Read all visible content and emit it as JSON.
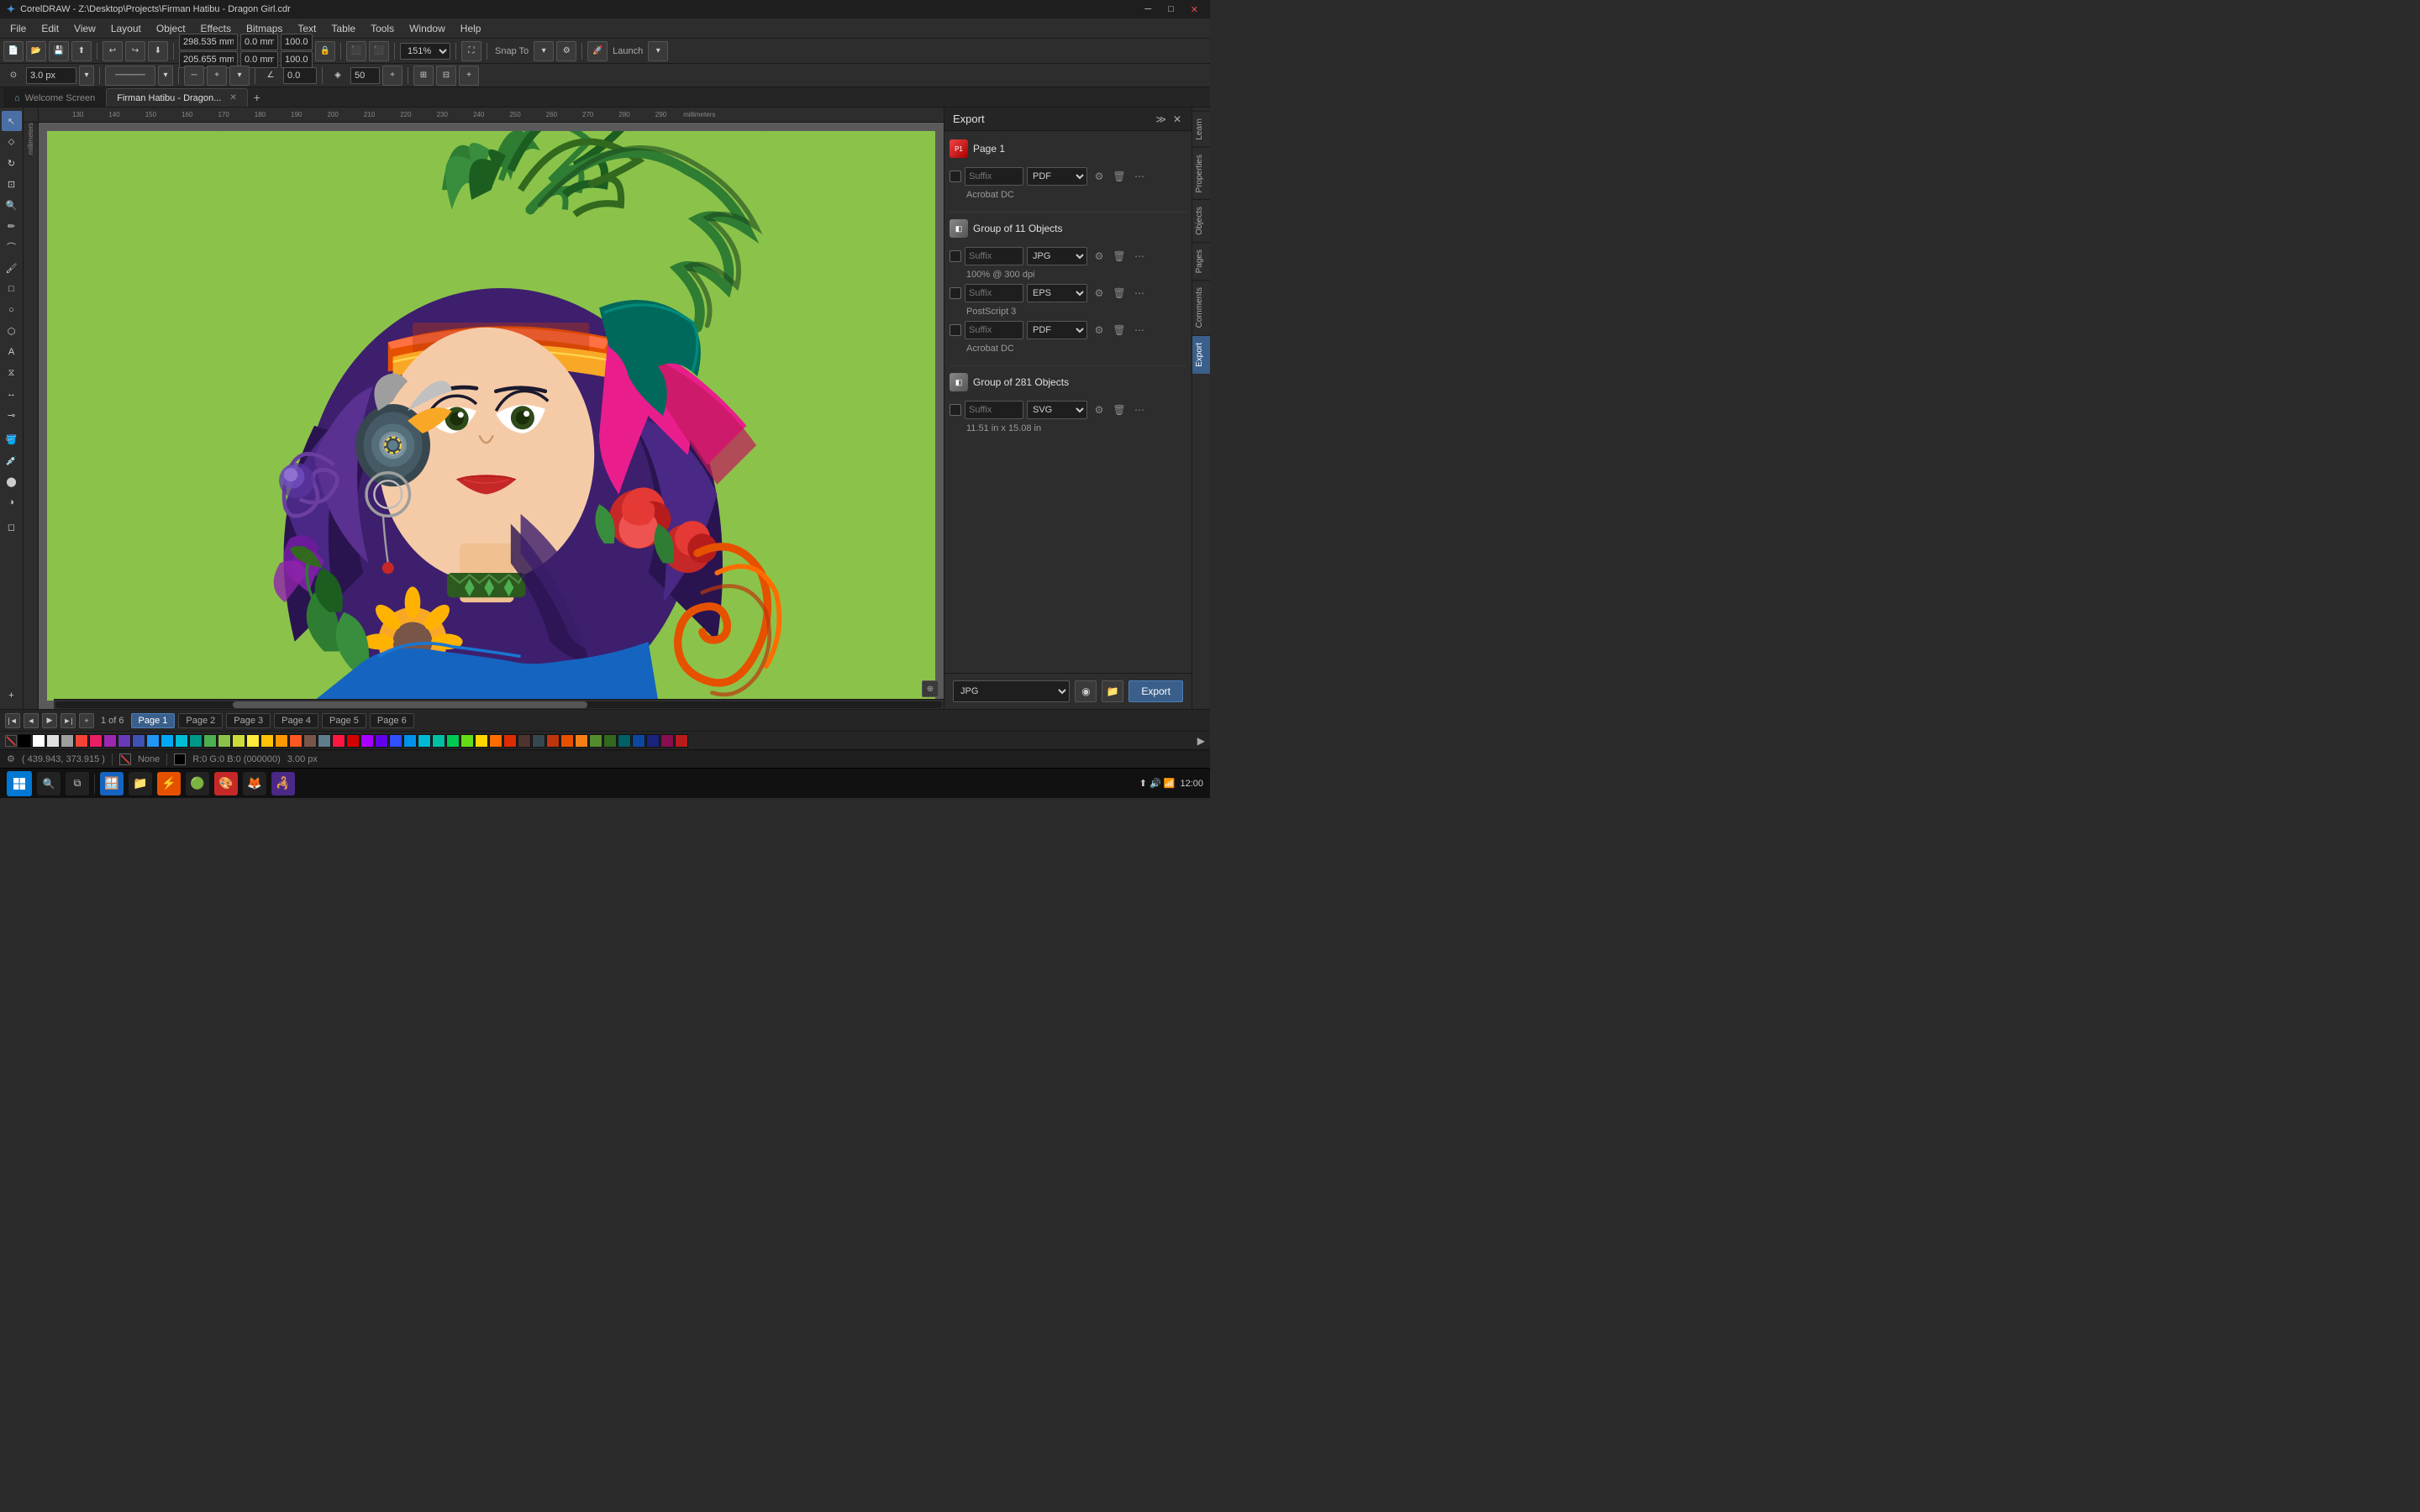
{
  "titlebar": {
    "title": "CorelDRAW - Z:\\Desktop\\Projects\\Firman Hatibu - Dragon Girl.cdr",
    "logo": "CDR",
    "minimize": "─",
    "maximize": "□",
    "close": "✕",
    "expand": "⤢"
  },
  "menubar": {
    "items": [
      "File",
      "Edit",
      "View",
      "Layout",
      "Object",
      "Effects",
      "Bitmaps",
      "Text",
      "Table",
      "Tools",
      "Window",
      "Help"
    ]
  },
  "toolbar1": {
    "new_label": "New",
    "open_label": "Open",
    "save_label": "Save",
    "x_value": "298.535 mm",
    "y_value": "205.655 mm",
    "w_value": "0.0 mm",
    "h_value": "0.0 mm",
    "w2_value": "100.0",
    "h2_value": "100.0",
    "zoom_value": "151%",
    "snap_label": "Snap To",
    "launch_label": "Launch"
  },
  "toolbar2": {
    "outline_value": "3.0 px",
    "angle_value": "0.0",
    "value2": "50"
  },
  "tabs": {
    "home_icon": "⌂",
    "welcome": "Welcome Screen",
    "active": "Firman Hatibu - Dragon...",
    "add": "+"
  },
  "canvas": {
    "zoom": "151%",
    "coordinates": "( 439.943, 373.915 )"
  },
  "pages": {
    "current": 1,
    "total": 6,
    "list": [
      "Page 1",
      "Page 2",
      "Page 3",
      "Page 4",
      "Page 5",
      "Page 6"
    ]
  },
  "export_panel": {
    "title": "Export",
    "expand_icon": "≫",
    "close_icon": "✕",
    "page1": {
      "label": "Page 1",
      "rows": [
        {
          "suffix_placeholder": "Suffix",
          "format": "PDF",
          "sub_text": "Acrobat DC"
        }
      ]
    },
    "group11": {
      "label": "Group of 11 Objects",
      "rows": [
        {
          "suffix_placeholder": "Suffix",
          "format": "JPG",
          "sub_text": "100% @ 300 dpi"
        },
        {
          "suffix_placeholder": "Suffix",
          "format": "EPS",
          "sub_text": "PostScript 3"
        },
        {
          "suffix_placeholder": "Suffix",
          "format": "PDF",
          "sub_text": "Acrobat DC"
        }
      ]
    },
    "group281": {
      "label": "Group of 281 Objects",
      "rows": [
        {
          "suffix_placeholder": "Suffix",
          "format": "SVG",
          "sub_text": "11.51 in x 15.08 in"
        }
      ]
    },
    "footer": {
      "format": "JPG",
      "export_label": "Export"
    }
  },
  "right_tabs": {
    "items": [
      "Learn",
      "Properties",
      "Objects",
      "Pages",
      "Comments",
      "Export"
    ]
  },
  "statusbar": {
    "coords": "( 439.943, 373.915 )",
    "fill_label": "None",
    "outline_label": "R:0 G:0 B:0 (000000)",
    "outline_width": "3.00 px"
  },
  "colorpalette": {
    "colors": [
      "#000000",
      "#ffffff",
      "#f5f5f5",
      "#e0e0e0",
      "#9e9e9e",
      "#616161",
      "#f44336",
      "#e91e63",
      "#9c27b0",
      "#673ab7",
      "#3f51b5",
      "#2196f3",
      "#03a9f4",
      "#00bcd4",
      "#009688",
      "#4caf50",
      "#8bc34a",
      "#cddc39",
      "#ffeb3b",
      "#ffc107",
      "#ff9800",
      "#ff5722",
      "#795548",
      "#607d8b",
      "#ff1744",
      "#d50000",
      "#aa00ff",
      "#6200ea",
      "#304ffe",
      "#2962ff",
      "#0091ea",
      "#00b8d4",
      "#00bfa5",
      "#00c853",
      "#64dd17",
      "#aeea00",
      "#ffd600",
      "#ffab00",
      "#ff6d00",
      "#dd2c00",
      "#4e342e",
      "#37474f",
      "#bf360c",
      "#e65100",
      "#f57f17",
      "#f9a825",
      "#558b2f",
      "#33691e",
      "#1b5e20",
      "#006064",
      "#0d47a1",
      "#1a237e",
      "#311b92",
      "#880e4f",
      "#b71c1c"
    ]
  }
}
